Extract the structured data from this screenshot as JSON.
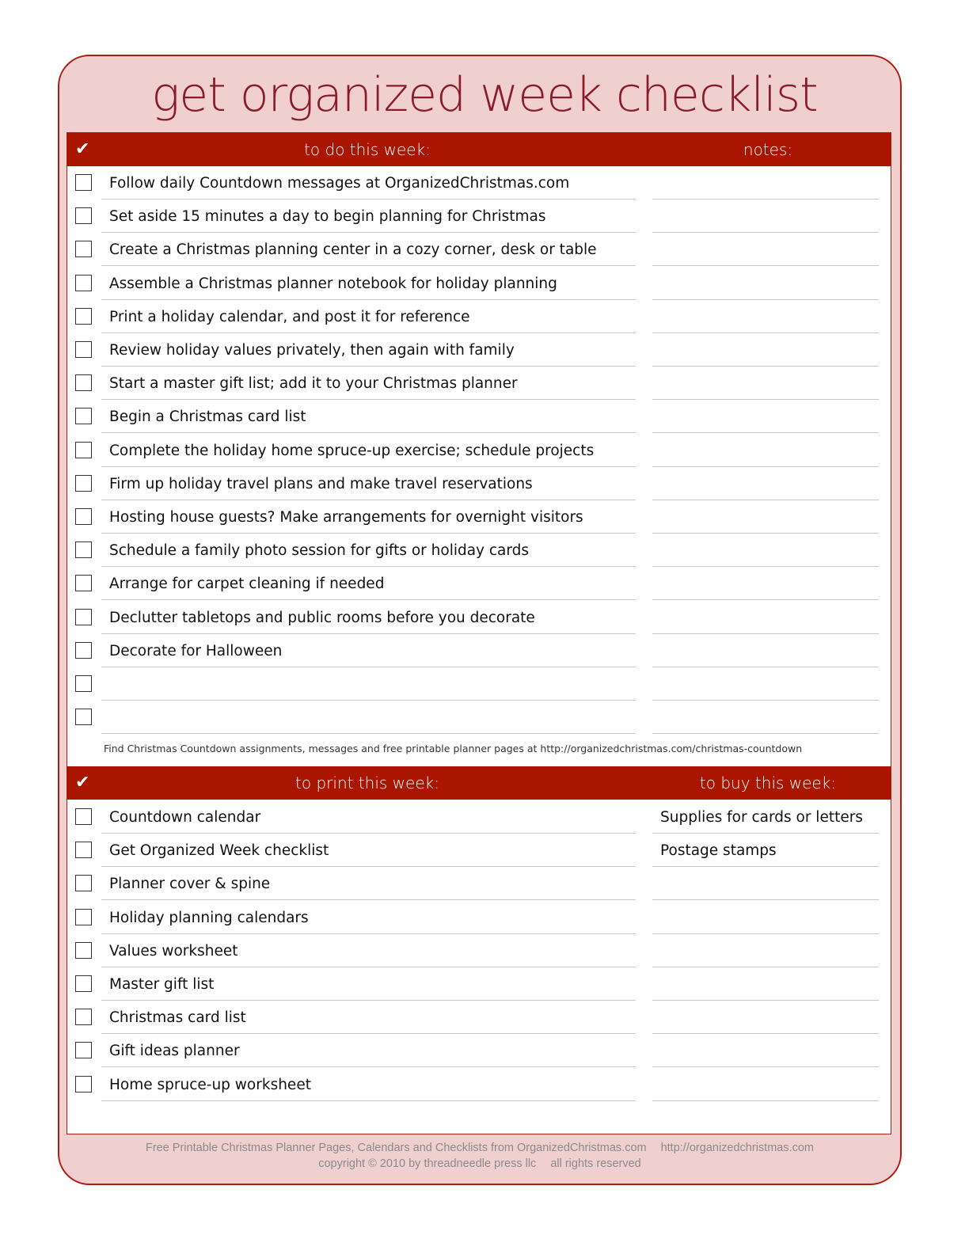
{
  "page": {
    "title": "get organized week checklist",
    "colors": {
      "accent": "#aa1500",
      "title": "#8b1a2b",
      "frame_fill": "#f0d0cf",
      "frame_border": "#b01c10"
    }
  },
  "todo_section": {
    "check_icon": "✔",
    "header_left": "to do this week:",
    "header_right": "notes:",
    "items": [
      {
        "task": "Follow daily Countdown messages at OrganizedChristmas.com",
        "note": ""
      },
      {
        "task": "Set aside 15 minutes a day to begin planning for Christmas",
        "note": ""
      },
      {
        "task": "Create a Christmas planning center in a cozy corner, desk or table",
        "note": ""
      },
      {
        "task": "Assemble a Christmas planner notebook for holiday planning",
        "note": ""
      },
      {
        "task": "Print a holiday calendar, and post it for reference",
        "note": ""
      },
      {
        "task": "Review holiday values privately, then again with family",
        "note": ""
      },
      {
        "task": "Start a master gift list; add it to your Christmas planner",
        "note": ""
      },
      {
        "task": "Begin a Christmas card list",
        "note": ""
      },
      {
        "task": "Complete the holiday home spruce-up exercise; schedule projects",
        "note": ""
      },
      {
        "task": "Firm up holiday travel plans and make travel reservations",
        "note": ""
      },
      {
        "task": "Hosting house guests? Make arrangements for overnight visitors",
        "note": ""
      },
      {
        "task": "Schedule a family photo session for gifts or holiday cards",
        "note": ""
      },
      {
        "task": "Arrange for carpet cleaning if needed",
        "note": ""
      },
      {
        "task": "Declutter tabletops and public rooms before you decorate",
        "note": ""
      },
      {
        "task": "Decorate for Halloween",
        "note": ""
      },
      {
        "task": "",
        "note": ""
      },
      {
        "task": "",
        "note": ""
      }
    ],
    "footnote": "Find Christmas Countdown assignments, messages and free printable planner pages at http://organizedchristmas.com/christmas-countdown"
  },
  "print_section": {
    "check_icon": "✔",
    "header_left": "to print this week:",
    "header_right": "to buy this week:",
    "items": [
      {
        "task": "Countdown calendar",
        "buy": "Supplies for cards or letters"
      },
      {
        "task": "Get Organized Week checklist",
        "buy": "Postage stamps"
      },
      {
        "task": "Planner cover & spine",
        "buy": ""
      },
      {
        "task": "Holiday planning calendars",
        "buy": ""
      },
      {
        "task": "Values worksheet",
        "buy": ""
      },
      {
        "task": "Master gift list",
        "buy": ""
      },
      {
        "task": "Christmas card list",
        "buy": ""
      },
      {
        "task": "Gift ideas planner",
        "buy": ""
      },
      {
        "task": "Home spruce-up worksheet",
        "buy": ""
      }
    ]
  },
  "footer": {
    "line1_left": "Free Printable Christmas Planner Pages, Calendars and Checklists from OrganizedChristmas.com",
    "line1_right": "http://organizedchristmas.com",
    "line2_left": "copyright © 2010 by threadneedle press llc",
    "line2_right": "all rights reserved"
  }
}
